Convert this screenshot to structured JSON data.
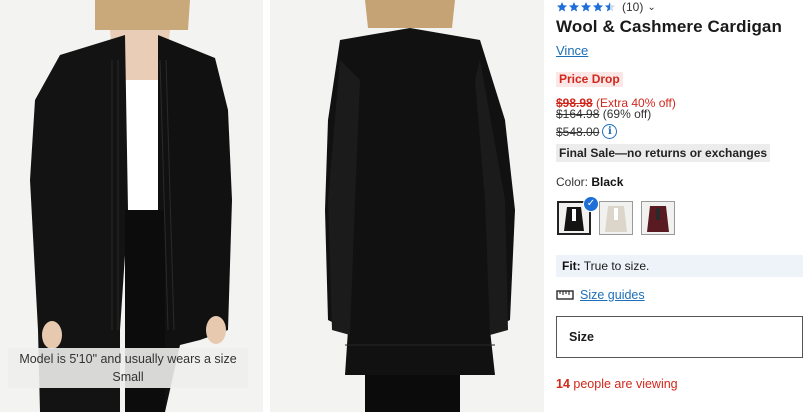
{
  "gallery": {
    "caption": "Model is 5'10\" and usually wears a size Small"
  },
  "product": {
    "rating_value": 4.5,
    "review_count": "(10)",
    "title": "Wool & Cashmere Cardigan",
    "brand": "Vince",
    "badge": "Price Drop",
    "sale_price": "$98.98",
    "sale_note": "(Extra 40% off)",
    "compare_price": "$164.98",
    "compare_note": "(69% off)",
    "original_price": "$548.00",
    "final_sale": "Final Sale—no returns or exchanges",
    "color_label": "Color:",
    "color_value": "Black",
    "colors": [
      "Black",
      "Ivory",
      "Burgundy"
    ],
    "fit_label": "Fit:",
    "fit_value": "True to size.",
    "size_guides": "Size guides",
    "size_label": "Size",
    "viewing_count": "14",
    "viewing_text": "people are viewing"
  },
  "colors_hex": {
    "accent_link": "#1d6fb8",
    "sale_red": "#d1271c",
    "star": "#1e6ed8"
  }
}
